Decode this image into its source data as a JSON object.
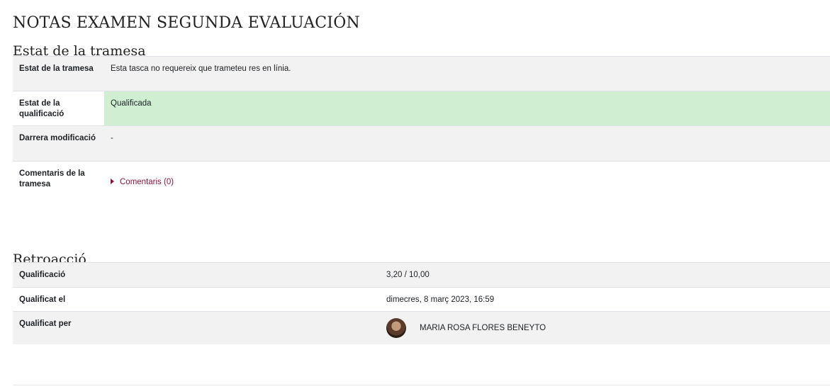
{
  "page": {
    "title": "NOTAS EXAMEN SEGUNDA EVALUACIÓN"
  },
  "submission": {
    "heading": "Estat de la tramesa",
    "rows": [
      {
        "label": "Estat de la tramesa",
        "value": "Esta tasca no requereix que trameteu res en línia."
      },
      {
        "label": "Estat de la qualificació",
        "value": "Qualificada"
      },
      {
        "label": "Darrera modificació",
        "value": "-"
      },
      {
        "label": "Comentaris de la tramesa",
        "value": "Comentaris (0)"
      }
    ]
  },
  "feedback": {
    "heading": "Retroacció",
    "rows": [
      {
        "label": "Qualificació",
        "value": "3,20 / 10,00"
      },
      {
        "label": "Qualificat el",
        "value": "dimecres, 8 març 2023, 16:59"
      },
      {
        "label": "Qualificat per",
        "value": "MARIA ROSA FLORES BENEYTO"
      }
    ]
  },
  "colors": {
    "graded_bg": "#cfeed2",
    "link": "#8a1538",
    "row_grey": "#f2f2f2"
  }
}
